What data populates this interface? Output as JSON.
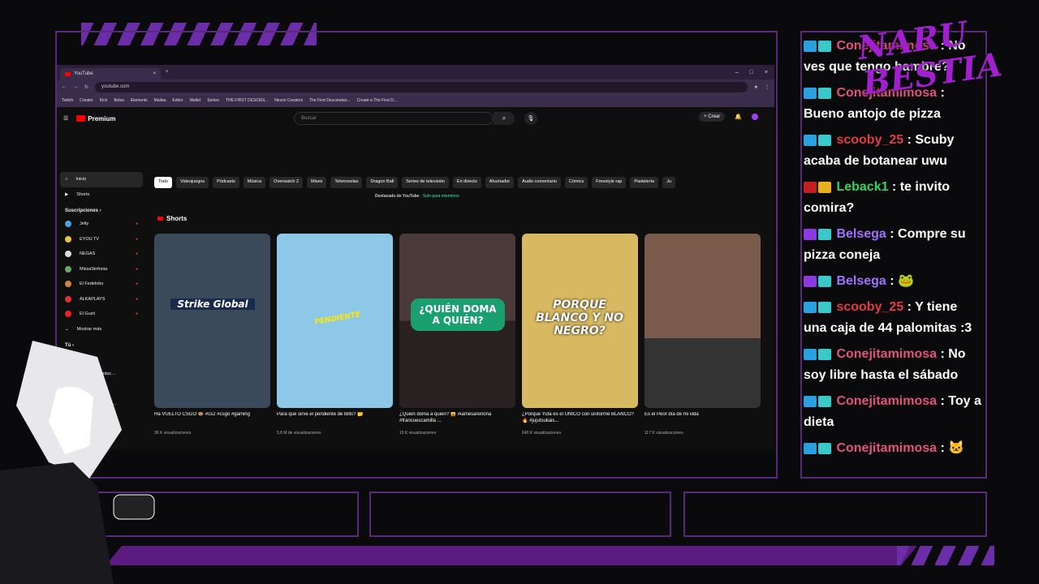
{
  "browser": {
    "tab_title": "YouTube",
    "url": "youtube.com",
    "bookmarks": [
      "Twitch",
      "Creator",
      "Kick",
      "Bolsa",
      "Elements",
      "Mailea",
      "Editor",
      "Wallet",
      "Sorteo",
      "THE FIRST DESCEN...",
      "Nexon Creators",
      "The First Descendan...",
      "Create a The First D..."
    ]
  },
  "youtube": {
    "logo": "Premium",
    "search_placeholder": "Buscar",
    "create_label": "Crear",
    "sidebar": {
      "main": [
        {
          "label": "Inicio"
        },
        {
          "label": "Shorts"
        }
      ],
      "subs_header": "Suscripciones",
      "subs": [
        {
          "label": "Jelty",
          "color": "#4aa3df"
        },
        {
          "label": "EYOU TV",
          "color": "#e8c340"
        },
        {
          "label": "NEGAS",
          "color": "#ddd"
        },
        {
          "label": "MissaSinfonia",
          "color": "#6a6"
        },
        {
          "label": "El Fedelobo",
          "color": "#c84"
        },
        {
          "label": "ALKAPLAYS",
          "color": "#d33"
        },
        {
          "label": "El Guzii",
          "color": "#e22"
        }
      ],
      "more": "Mostrar más",
      "you_header": "Tú",
      "you": [
        {
          "label": "Historial"
        },
        {
          "label": "Listas de reproduc..."
        },
        {
          "label": "Ver más tarde"
        },
        {
          "label": "Videos que me gus..."
        },
        {
          "label": "Videos"
        },
        {
          "label": "Clips"
        },
        {
          "label": "Más"
        }
      ]
    },
    "chips": [
      "Todo",
      "Videojuegos",
      "Pódcasts",
      "Música",
      "Overwatch 2",
      "Mixes",
      "Telenovelas",
      "Dragon Ball",
      "Series de televisión",
      "En directo",
      "Ahumador",
      "Audio comentario",
      "Cómics",
      "Freestyle rap",
      "Pastelería",
      "Ju"
    ],
    "featured": "Destacado de YouTube",
    "featured_tag": "Solo para miembros",
    "shorts_title": "Shorts",
    "shorts": [
      {
        "title": "Ha VUELTO CSGO 🐵 #cs2 #csgo #gaming",
        "views": "36 K visualizaciones",
        "overlay": "Strike Global",
        "bg": "#3a4a5a"
      },
      {
        "title": "Para que sirve el pendiente de Bills? 🤔",
        "views": "5,8 M de visualizaciones",
        "overlay": "PENDIENTE",
        "bg": "#8ec8e8"
      },
      {
        "title": "¿Quién doma a quién? 🙀 #iamesareñoña #francoescamilla ...",
        "views": "10 K visualizaciones",
        "overlay": "¿QUIÉN DOMA A QUIÉN?",
        "bg": "#4a3a3a"
      },
      {
        "title": "¿Porque Yuta es el ÚNICO con uniforme BLANCO? 🔥 #jujutsukais...",
        "views": "640 K visualizaciones",
        "overlay": "PORQUE BLANCO Y NO NEGRO?",
        "bg": "#d8b860"
      },
      {
        "title": "Es el Peor día de mi vida",
        "views": "117 K visualizaciones",
        "overlay": "",
        "bg": "#8a6a5a"
      }
    ]
  },
  "chat": [
    {
      "name": "Conejitamimosa",
      "text": ": No ves que tengo hambre?",
      "cls": ""
    },
    {
      "name": "Conejitamimosa",
      "text": ": Bueno antojo de pizza",
      "cls": ""
    },
    {
      "name": "scooby_25",
      "text": ": Scuby acaba de botanear uwu",
      "cls": "r"
    },
    {
      "name": "Leback1",
      "text": ": te invito comira?",
      "cls": "g"
    },
    {
      "name": "Belsega",
      "text": ": Compre su pizza coneja",
      "cls": "p"
    },
    {
      "name": "Belsega",
      "text": ": 🐸",
      "cls": "p"
    },
    {
      "name": "scooby_25",
      "text": ": Y tiene una caja de 44 palomitas :3",
      "cls": "r"
    },
    {
      "name": "Conejitamimosa",
      "text": ": No soy libre hasta el sábado",
      "cls": ""
    },
    {
      "name": "Conejitamimosa",
      "text": ": Toy a dieta",
      "cls": ""
    },
    {
      "name": "Conejitamimosa",
      "text": ": 🐱",
      "cls": ""
    }
  ],
  "brand": "NARU BESTIA"
}
